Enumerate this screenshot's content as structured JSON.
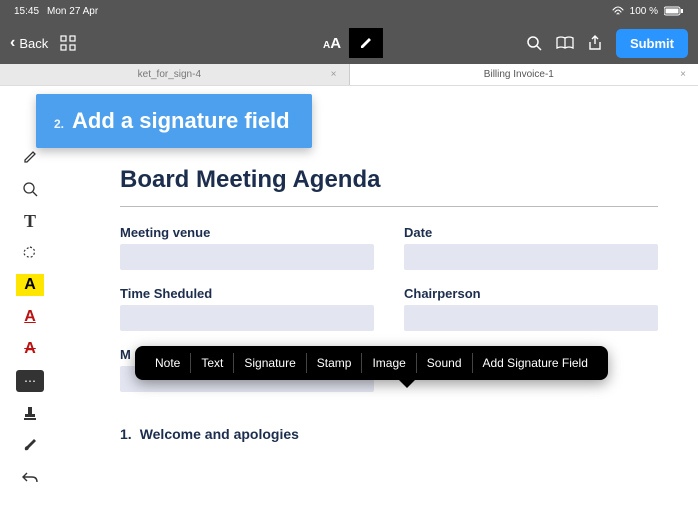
{
  "status": {
    "time": "15:45",
    "date": "Mon 27 Apr",
    "battery": "100 %",
    "wifi": "wifi"
  },
  "nav": {
    "back": "Back",
    "submit": "Submit"
  },
  "tabs": [
    {
      "label": "ket_for_sign-4",
      "closeable": true
    },
    {
      "label": "Billing Invoice-1",
      "closeable": true
    }
  ],
  "callout": {
    "number": "2.",
    "text": "Add a signature field"
  },
  "document": {
    "title": "Board Meeting Agenda",
    "fields": {
      "venue": "Meeting venue",
      "date": "Date",
      "time": "Time Sheduled",
      "chair": "Chairperson",
      "m": "M"
    },
    "ol": [
      {
        "num": "1.",
        "text": "Welcome and apologies"
      }
    ]
  },
  "popover": {
    "items": [
      "Note",
      "Text",
      "Signature",
      "Stamp",
      "Image",
      "Sound",
      "Add Signature Field"
    ]
  },
  "left_tools": {
    "pen": "pen",
    "zoom": "zoom",
    "text": "T",
    "lasso": "lasso",
    "hl": "A",
    "ul": "A",
    "st": "A",
    "chat": "⋯",
    "stamp": "stamp",
    "brush": "brush",
    "undo": "undo"
  }
}
